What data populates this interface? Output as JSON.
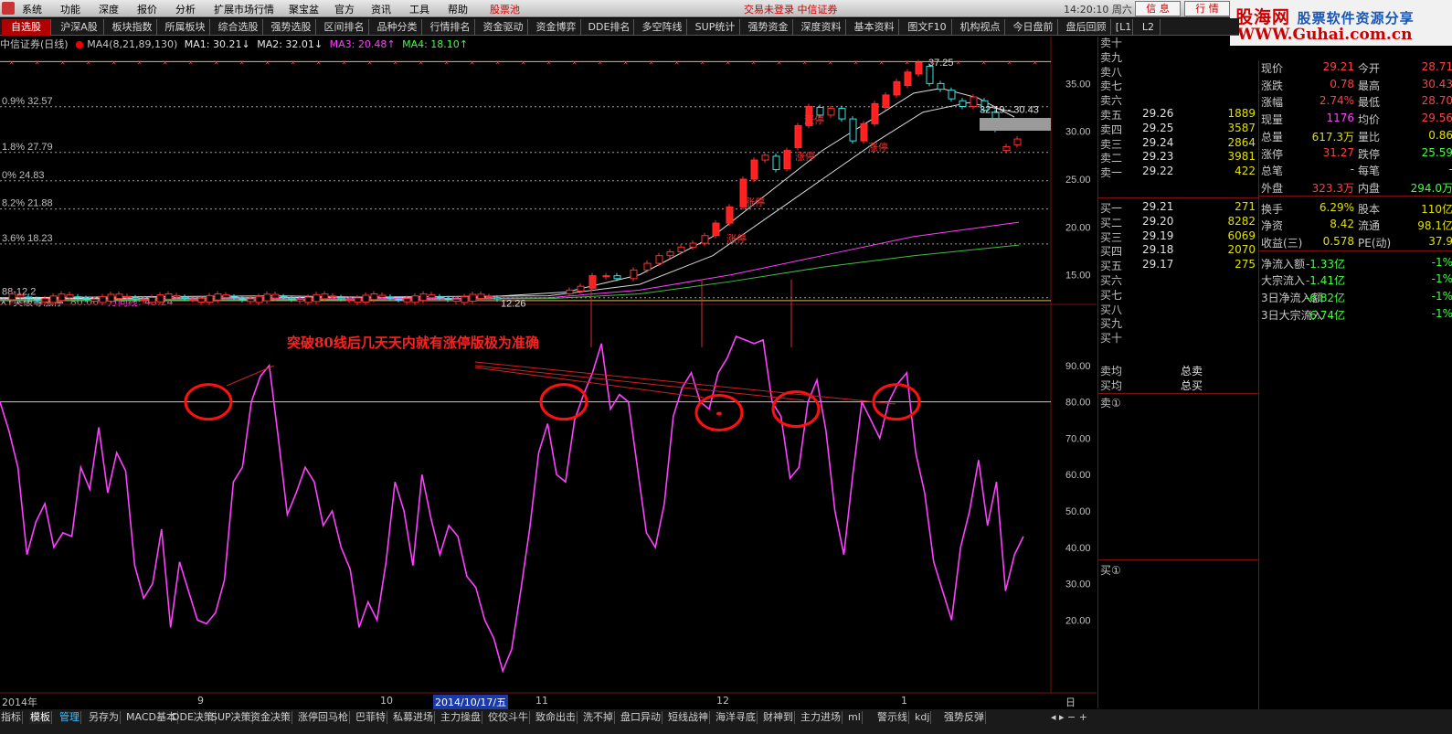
{
  "menu": {
    "items": [
      "系统",
      "功能",
      "深度",
      "报价",
      "分析",
      "扩展市场行情",
      "聚宝盆",
      "官方",
      "资讯",
      "工具",
      "帮助"
    ],
    "stock_pool": "股票池",
    "status": "交易未登录   中信证券",
    "time": "14:20:10 周六",
    "info_btn": "信 息",
    "quote_btn": "行 情"
  },
  "logo": {
    "name_part1": "股海网",
    "name_part2": "股票软件资源分享",
    "url": "WWW.Guhai.com.cn"
  },
  "tabs": [
    "自选股",
    "沪深A股",
    "板块指数",
    "所属板块",
    "综合选股",
    "强势选股",
    "区间排名",
    "品种分类",
    "行情排名",
    "资金驱动",
    "资金博弈",
    "DDE排名",
    "多空阵线",
    "SUP统计",
    "强势资金",
    "深度资料",
    "基本资料",
    "图文F10",
    "机构视点",
    "今日盘前",
    "盘后回顾",
    "[L1",
    "L2"
  ],
  "main_chart": {
    "stock": "中信证券(日线)",
    "ma4_params": "MA4(8,21,89,130)",
    "ma1": "MA1: 30.21",
    "ma2": "MA2: 32.01",
    "ma3": "MA3: 20.48",
    "ma4": "MA4: 18.10",
    "high_label": "37.25",
    "low_label": "12.26",
    "range_label": "32.19 - 30.43",
    "fib_labels": [
      "0.9% 32.57",
      "1.8% 27.79",
      "0% 24.83",
      "8.2% 21.88",
      "3.6% 18.23",
      "88-12.2"
    ],
    "limit_label": "涨停"
  },
  "sub_chart": {
    "indicator": "XY突破等涨停",
    "line_value": "80.00",
    "direction_label": "方向线: 43.24",
    "annotation": "突破80线后几天天内就有涨停版极为准确"
  },
  "chart_data": {
    "type": "line",
    "x_labels": [
      "2014年",
      "9",
      "10",
      "2014/10/17/五",
      "11",
      "12",
      "1"
    ],
    "price_axis": [
      "35.00",
      "30.00",
      "25.00",
      "20.00",
      "15.00"
    ],
    "indicator_axis": [
      "90.00",
      "80.00",
      "70.00",
      "60.00",
      "50.00",
      "40.00",
      "30.00",
      "20.00"
    ],
    "indicator_threshold": 80,
    "indicator_series": [
      80,
      72,
      62,
      38,
      47,
      52,
      40,
      44,
      43,
      62,
      56,
      73,
      55,
      66,
      61,
      35,
      26,
      30,
      45,
      18,
      36,
      28,
      20,
      19,
      22,
      31,
      58,
      62,
      80,
      87,
      90,
      70,
      49,
      55,
      62,
      58,
      46,
      50,
      40,
      34,
      18,
      25,
      20,
      36,
      58,
      50,
      35,
      60,
      48,
      38,
      46,
      43,
      32,
      29,
      20,
      15,
      6,
      12,
      28,
      45,
      66,
      74,
      60,
      58,
      75,
      82,
      88,
      96,
      78,
      82,
      80,
      62,
      44,
      40,
      52,
      76,
      84,
      88,
      80,
      78,
      88,
      92,
      98,
      97,
      96,
      97,
      80,
      76,
      59,
      62,
      80,
      86,
      72,
      50,
      38,
      60,
      80,
      75,
      70,
      80,
      85,
      88,
      66,
      55,
      36,
      28,
      20,
      40,
      50,
      64,
      46,
      58,
      28,
      38,
      43
    ]
  },
  "orderbook": {
    "sell": [
      {
        "label": "卖十",
        "price": "",
        "vol": ""
      },
      {
        "label": "卖九",
        "price": "",
        "vol": ""
      },
      {
        "label": "卖八",
        "price": "",
        "vol": ""
      },
      {
        "label": "卖七",
        "price": "",
        "vol": ""
      },
      {
        "label": "卖六",
        "price": "",
        "vol": ""
      },
      {
        "label": "卖五",
        "price": "29.26",
        "vol": "1889"
      },
      {
        "label": "卖四",
        "price": "29.25",
        "vol": "3587"
      },
      {
        "label": "卖三",
        "price": "29.24",
        "vol": "2864"
      },
      {
        "label": "卖二",
        "price": "29.23",
        "vol": "3981"
      },
      {
        "label": "卖一",
        "price": "29.22",
        "vol": "422"
      }
    ],
    "buy": [
      {
        "label": "买一",
        "price": "29.21",
        "vol": "271"
      },
      {
        "label": "买二",
        "price": "29.20",
        "vol": "8282"
      },
      {
        "label": "买三",
        "price": "29.19",
        "vol": "6069"
      },
      {
        "label": "买四",
        "price": "29.18",
        "vol": "2070"
      },
      {
        "label": "买五",
        "price": "29.17",
        "vol": "275"
      },
      {
        "label": "买六",
        "price": "",
        "vol": ""
      },
      {
        "label": "买七",
        "price": "",
        "vol": ""
      },
      {
        "label": "买八",
        "price": "",
        "vol": ""
      },
      {
        "label": "买九",
        "price": "",
        "vol": ""
      },
      {
        "label": "买十",
        "price": "",
        "vol": ""
      }
    ],
    "sell_avg": "卖均",
    "buy_avg": "买均",
    "total_sell": "总卖",
    "total_buy": "总买",
    "sell_queue": "卖①",
    "buy_queue": "买①"
  },
  "stats": [
    {
      "l1": "现价",
      "v1": "29.21",
      "c1": "#ff4040",
      "l2": "今开",
      "v2": "28.71",
      "c2": "#ff4040"
    },
    {
      "l1": "涨跌",
      "v1": "0.78",
      "c1": "#ff4040",
      "l2": "最高",
      "v2": "30.43",
      "c2": "#ff4040"
    },
    {
      "l1": "涨幅",
      "v1": "2.74%",
      "c1": "#ff4040",
      "l2": "最低",
      "v2": "28.70",
      "c2": "#ff4040"
    },
    {
      "l1": "现量",
      "v1": "1176",
      "c1": "#ff40ff",
      "l2": "均价",
      "v2": "29.56",
      "c2": "#ff4040"
    },
    {
      "l1": "总量",
      "v1": "617.3万",
      "c1": "#e0e000",
      "l2": "量比",
      "v2": "0.86",
      "c2": "#e0e000"
    },
    {
      "l1": "涨停",
      "v1": "31.27",
      "c1": "#ff4040",
      "l2": "跌停",
      "v2": "25.59",
      "c2": "#40ff40"
    },
    {
      "l1": "总笔",
      "v1": "-",
      "c1": "#e0e000",
      "l2": "每笔",
      "v2": "-",
      "c2": "#e0e000"
    },
    {
      "l1": "外盘",
      "v1": "323.3万",
      "c1": "#ff4040",
      "l2": "内盘",
      "v2": "294.0万",
      "c2": "#40ff40"
    },
    {
      "l1": "换手",
      "v1": "6.29%",
      "c1": "#e0e000",
      "l2": "股本",
      "v2": "110亿",
      "c2": "#e0e000"
    },
    {
      "l1": "净资",
      "v1": "8.42",
      "c1": "#e0e000",
      "l2": "流通",
      "v2": "98.1亿",
      "c2": "#e0e000"
    },
    {
      "l1": "收益(三)",
      "v1": "0.578",
      "c1": "#e0e000",
      "l2": "PE(动)",
      "v2": "37.9",
      "c2": "#e0e000"
    },
    {
      "l1": "净流入额",
      "v1": "-1.33亿",
      "c1": "#40ff40",
      "l2": "",
      "v2": "-1%",
      "c2": "#40ff40"
    },
    {
      "l1": "大宗流入",
      "v1": "-1.41亿",
      "c1": "#40ff40",
      "l2": "",
      "v2": "-1%",
      "c2": "#40ff40"
    },
    {
      "l1": "3日净流入额",
      "v1": "-6.82亿",
      "c1": "#40ff40",
      "l2": "",
      "v2": "-1%",
      "c2": "#40ff40"
    },
    {
      "l1": "3日大宗流入",
      "v1": "-6.74亿",
      "c1": "#40ff40",
      "l2": "",
      "v2": "-1%",
      "c2": "#40ff40"
    }
  ],
  "bottom_tabs": [
    "指标",
    "模板",
    "管理",
    "另存为",
    "MACD基本",
    "DDE决策",
    "SUP决策",
    "资金决策",
    "涨停回马枪",
    "巴菲特",
    "私募进场",
    "主力操盘",
    "佼佼斗牛",
    "致命出击",
    "洗不掉",
    "盘口异动",
    "短线战神",
    "海洋寻底",
    "财神到",
    "主力进场",
    "ml",
    "警示线",
    "kdj",
    "强势反弹"
  ],
  "period": "日线"
}
